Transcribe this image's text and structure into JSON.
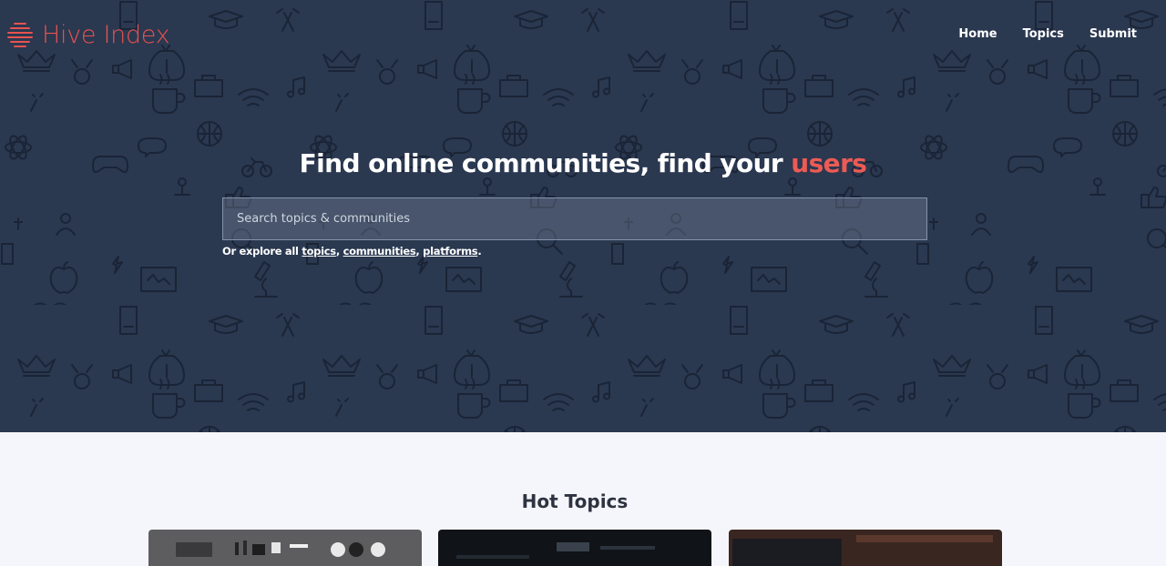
{
  "brand": {
    "name": "Hive Index"
  },
  "nav": {
    "items": [
      {
        "label": "Home"
      },
      {
        "label": "Topics"
      },
      {
        "label": "Submit"
      }
    ]
  },
  "hero": {
    "headline_main": "Find online communities, find your ",
    "headline_accent": "users",
    "search": {
      "placeholder": "Search topics & communities",
      "value": ""
    },
    "explore": {
      "prefix": "Or explore all ",
      "links": [
        {
          "label": "topics"
        },
        {
          "label": "communities"
        },
        {
          "label": "platforms"
        }
      ],
      "separator": ", ",
      "suffix": "."
    }
  },
  "hot_topics": {
    "title": "Hot Topics"
  },
  "colors": {
    "hero_bg": "#2a3850",
    "brand_accent": "#e8524f",
    "headline_accent": "#ec5b55",
    "page_bg": "#f5f6fb"
  }
}
